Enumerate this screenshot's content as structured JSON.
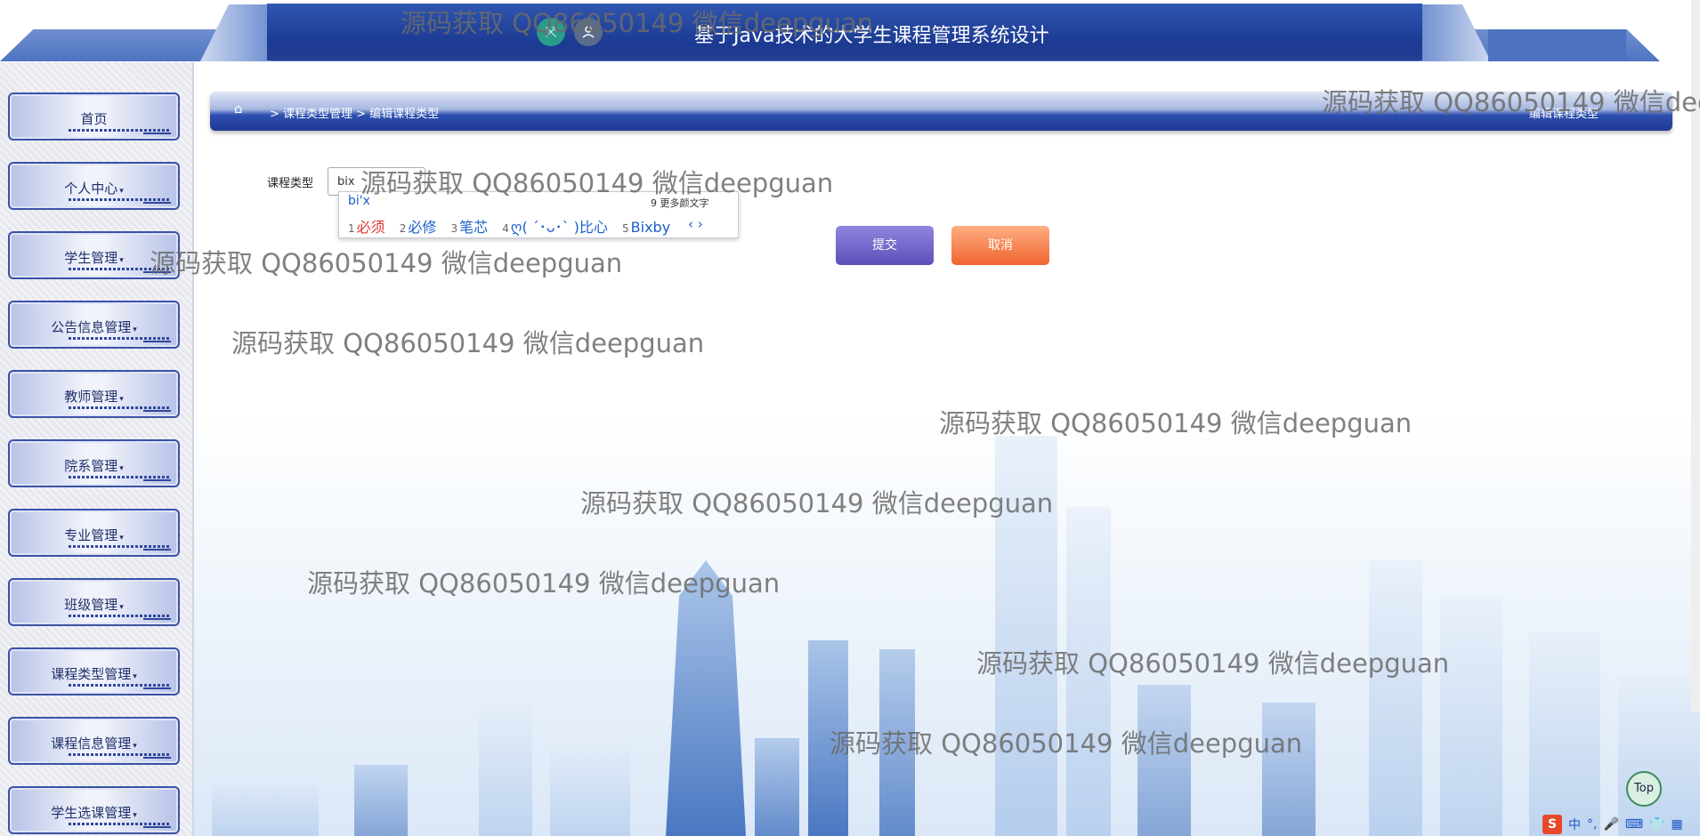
{
  "header": {
    "title": "基于Java技术的大学生课程管理系统设计",
    "icons": [
      "share-icon",
      "user-icon"
    ]
  },
  "sidebar": {
    "items": [
      {
        "label": "首页",
        "caret": ""
      },
      {
        "label": "个人中心",
        "caret": "▾"
      },
      {
        "label": "学生管理",
        "caret": "▾"
      },
      {
        "label": "公告信息管理",
        "caret": "▾"
      },
      {
        "label": "教师管理",
        "caret": "▾"
      },
      {
        "label": "院系管理",
        "caret": "▾"
      },
      {
        "label": "专业管理",
        "caret": "▾"
      },
      {
        "label": "班级管理",
        "caret": "▾"
      },
      {
        "label": "课程类型管理",
        "caret": "▾"
      },
      {
        "label": "课程信息管理",
        "caret": "▾"
      },
      {
        "label": "学生选课管理",
        "caret": "▾"
      }
    ]
  },
  "breadcrumb": {
    "text": "> 课程类型管理 > 编辑课程类型",
    "right_title": "编辑课程类型"
  },
  "form": {
    "label": "课程类型",
    "value": "bix"
  },
  "ime": {
    "pinyin": "bi'x",
    "more": "9 更多颜文字",
    "candidates": [
      {
        "n": "1",
        "text": "必须"
      },
      {
        "n": "2",
        "text": "必修"
      },
      {
        "n": "3",
        "text": "笔芯"
      },
      {
        "n": "4",
        "text": "ღ( ´･ᴗ･` )比心"
      },
      {
        "n": "5",
        "text": "Bixby"
      }
    ],
    "nav": "‹ ›"
  },
  "buttons": {
    "submit": "提交",
    "cancel": "取消",
    "top": "Top"
  },
  "tray": {
    "sogou": "S",
    "items": [
      "中",
      "°,",
      "🎤",
      "⌨",
      "👕",
      "▦"
    ]
  },
  "watermark": "源码获取 QQ86050149 微信deepguan",
  "colors": {
    "header": "#1c3a92",
    "submit": "#5d4fb8",
    "cancel": "#f0642e",
    "sidebar_border": "#3a52a6"
  }
}
